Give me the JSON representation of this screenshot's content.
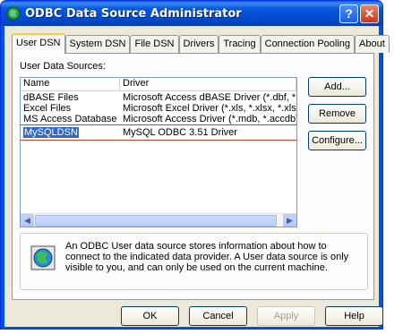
{
  "window": {
    "title": "ODBC Data Source Administrator",
    "help_label": "?",
    "close_label": "✕"
  },
  "tabs": [
    {
      "label": "User DSN",
      "active": true
    },
    {
      "label": "System DSN",
      "active": false
    },
    {
      "label": "File DSN",
      "active": false
    },
    {
      "label": "Drivers",
      "active": false
    },
    {
      "label": "Tracing",
      "active": false
    },
    {
      "label": "Connection Pooling",
      "active": false
    },
    {
      "label": "About",
      "active": false
    }
  ],
  "user_dsn": {
    "section_label": "User Data Sources:",
    "columns": {
      "name": "Name",
      "driver": "Driver"
    },
    "rows": [
      {
        "name": "dBASE Files",
        "driver": "Microsoft Access dBASE Driver (*.dbf, *.ndx"
      },
      {
        "name": "Excel Files",
        "driver": "Microsoft Excel Driver (*.xls, *.xlsx, *.xlsm, *.x"
      },
      {
        "name": "MS Access Database",
        "driver": "Microsoft Access Driver (*.mdb, *.accdb)"
      },
      {
        "name": "MySQLDSN",
        "driver": "MySQL ODBC 3.51 Driver",
        "selected": true
      }
    ],
    "side_buttons": {
      "add": "Add...",
      "remove": "Remove",
      "configure": "Configure..."
    },
    "info_text": "An ODBC User data source stores information about how to connect to the indicated data provider.   A User data source is only visible to you, and can only be used on the current machine."
  },
  "footer_buttons": {
    "ok": "OK",
    "cancel": "Cancel",
    "apply": "Apply",
    "help": "Help"
  },
  "stray": {
    "left_char_1": "e",
    "left_char_2": "s"
  },
  "colors": {
    "titlebar": "#0054e3",
    "selection": "#316ac5",
    "dialog_bg": "#ece9d8",
    "active_tab_accent": "#ffc83c"
  }
}
